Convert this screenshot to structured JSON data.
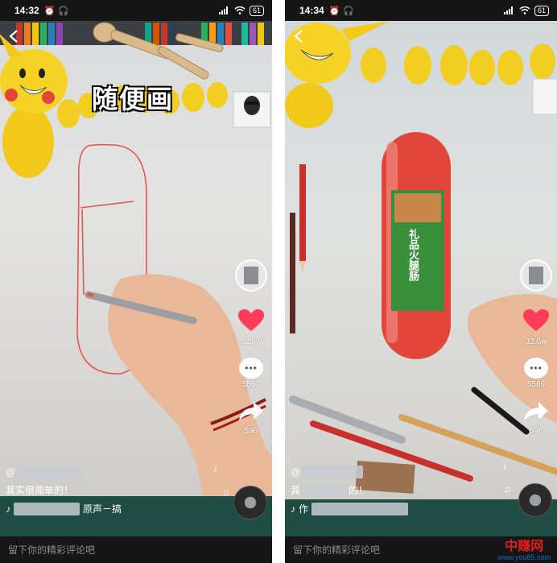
{
  "screens": [
    {
      "status": {
        "time": "14:32",
        "battery": "61"
      },
      "overlay_title": "随便画",
      "likes": "32.6w",
      "comments": "5567",
      "shares": "596",
      "handle_prefix": "@",
      "caption": "其实很简单的！",
      "music_text": "原声－搞",
      "comment_placeholder": "留下你的精彩评论吧"
    },
    {
      "status": {
        "time": "14:34",
        "battery": "61"
      },
      "likes": "32.6w",
      "comments": "5569",
      "shares": "596",
      "handle_prefix": "@",
      "caption_prefix": "其",
      "caption_suffix": "的！",
      "music_prefix": "作",
      "sausage_label": "礼品火腿肠",
      "comment_placeholder": "留下你的精彩评论吧"
    }
  ],
  "watermark": {
    "title": "中赚网",
    "url": "www.you85.com"
  },
  "colors": {
    "red_marker": "#e4574c",
    "heart": "#ff3d5a",
    "status_bg": "#161616"
  }
}
